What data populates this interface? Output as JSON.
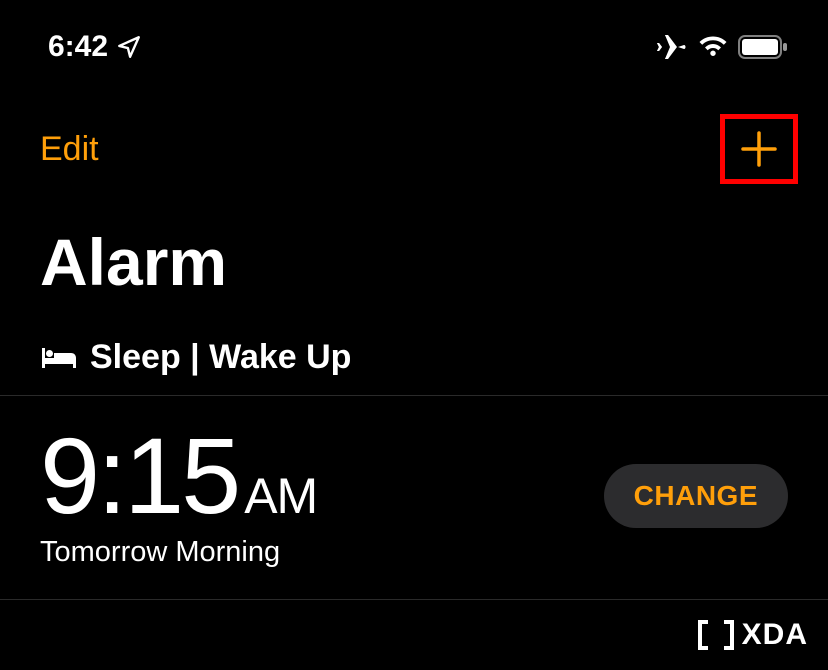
{
  "status_bar": {
    "time": "6:42"
  },
  "nav": {
    "edit_label": "Edit"
  },
  "page_title": "Alarm",
  "section": {
    "title": "Sleep | Wake Up"
  },
  "alarm": {
    "time": "9:15",
    "period": "AM",
    "subtitle": "Tomorrow Morning",
    "change_label": "CHANGE"
  },
  "watermark": {
    "text": "XDA"
  },
  "colors": {
    "accent": "#ff9f0a",
    "highlight_box": "#ff0000"
  }
}
